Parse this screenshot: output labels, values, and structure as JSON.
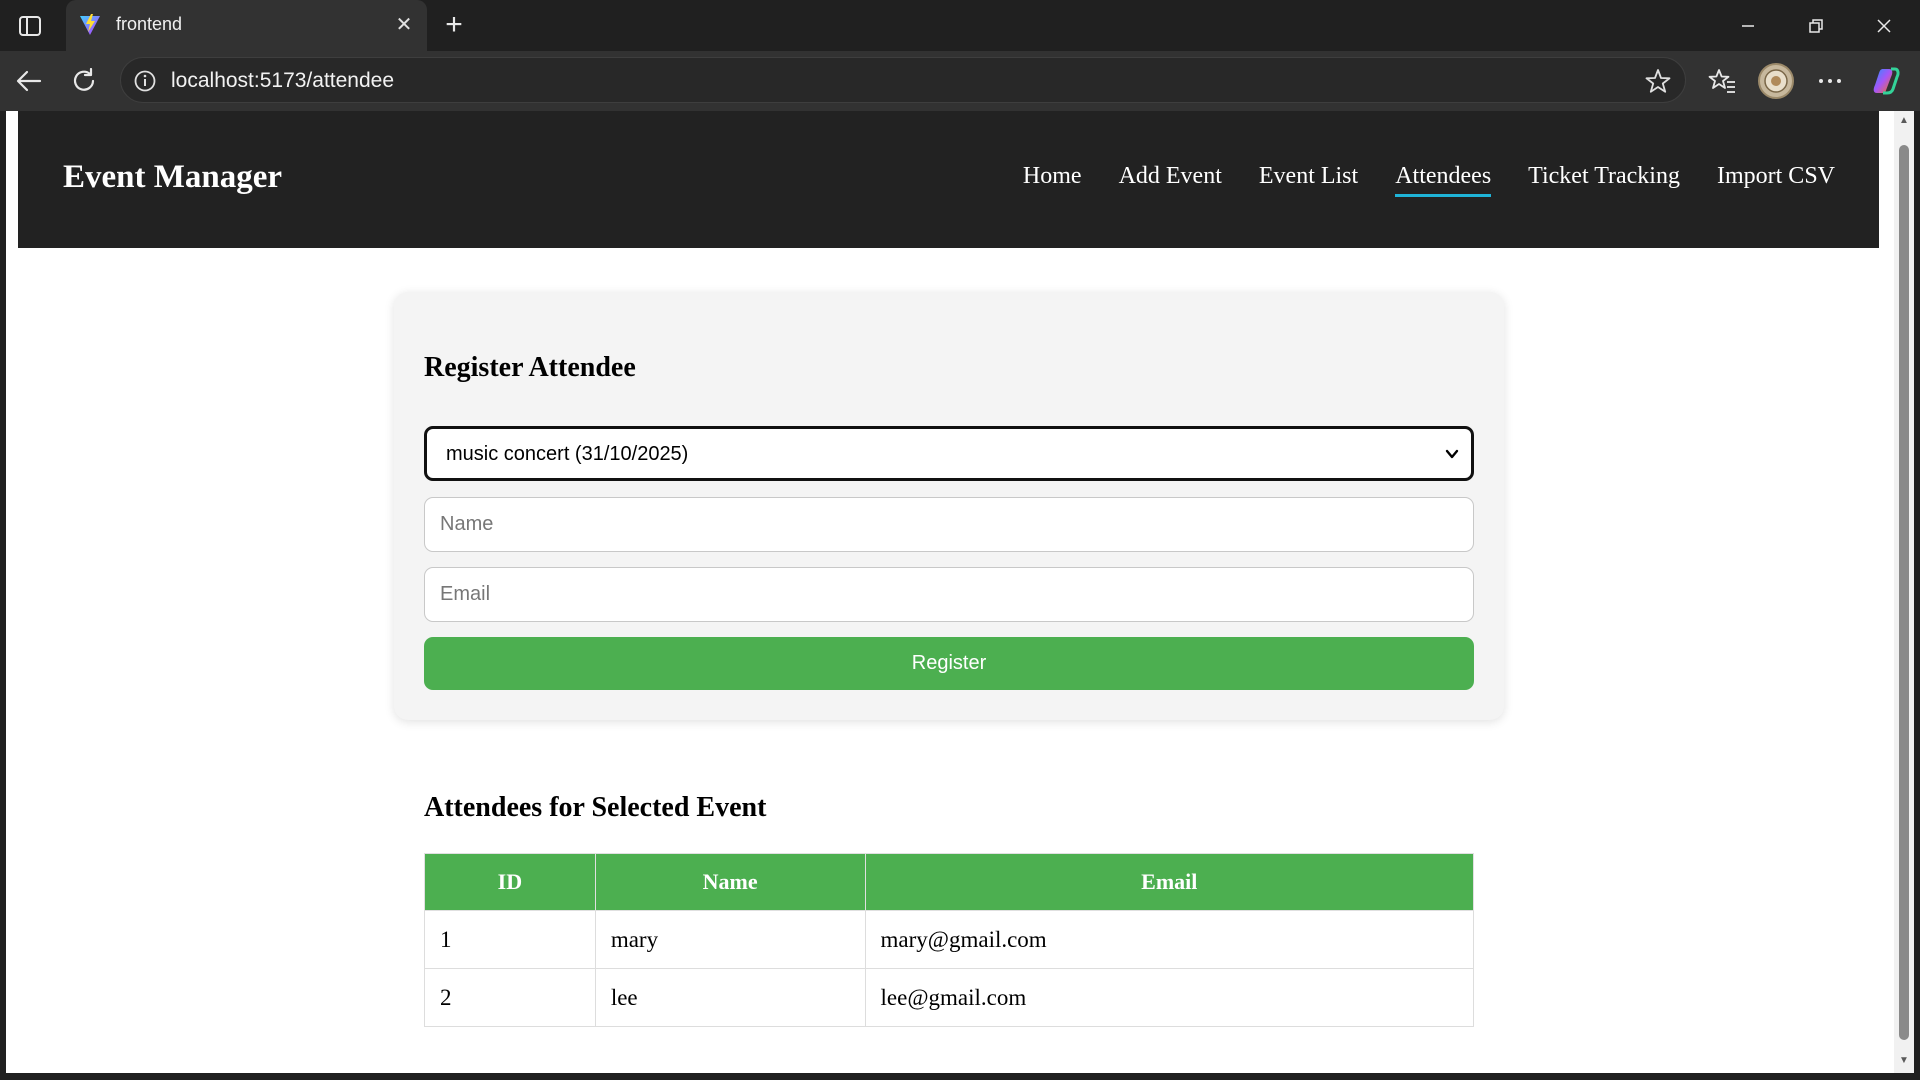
{
  "browser": {
    "tab_title": "frontend",
    "url": "localhost:5173/attendee",
    "icons": {
      "sidebar": "tab-sidebar-icon",
      "favicon": "vite-favicon",
      "close": "close-icon",
      "new_tab": "plus-icon",
      "back": "back-arrow-icon",
      "refresh": "refresh-icon",
      "info": "info-icon",
      "star": "star-icon",
      "favorites": "favorites-icon",
      "more": "more-icon",
      "copilot": "copilot-icon"
    }
  },
  "app": {
    "brand": "Event Manager",
    "nav": [
      {
        "label": "Home",
        "active": false
      },
      {
        "label": "Add Event",
        "active": false
      },
      {
        "label": "Event List",
        "active": false
      },
      {
        "label": "Attendees",
        "active": true
      },
      {
        "label": "Ticket Tracking",
        "active": false
      },
      {
        "label": "Import CSV",
        "active": false
      }
    ]
  },
  "register_form": {
    "title": "Register Attendee",
    "event_select_value": "music concert (31/10/2025)",
    "name_placeholder": "Name",
    "email_placeholder": "Email",
    "submit_label": "Register"
  },
  "attendees": {
    "title": "Attendees for Selected Event",
    "columns": [
      "ID",
      "Name",
      "Email"
    ],
    "rows": [
      {
        "id": "1",
        "name": "mary",
        "email": "mary@gmail.com"
      },
      {
        "id": "2",
        "name": "lee",
        "email": "lee@gmail.com"
      }
    ]
  },
  "colors": {
    "accent_green": "#4caf50",
    "header_bg": "#222222",
    "active_underline": "#1fb4d8"
  }
}
